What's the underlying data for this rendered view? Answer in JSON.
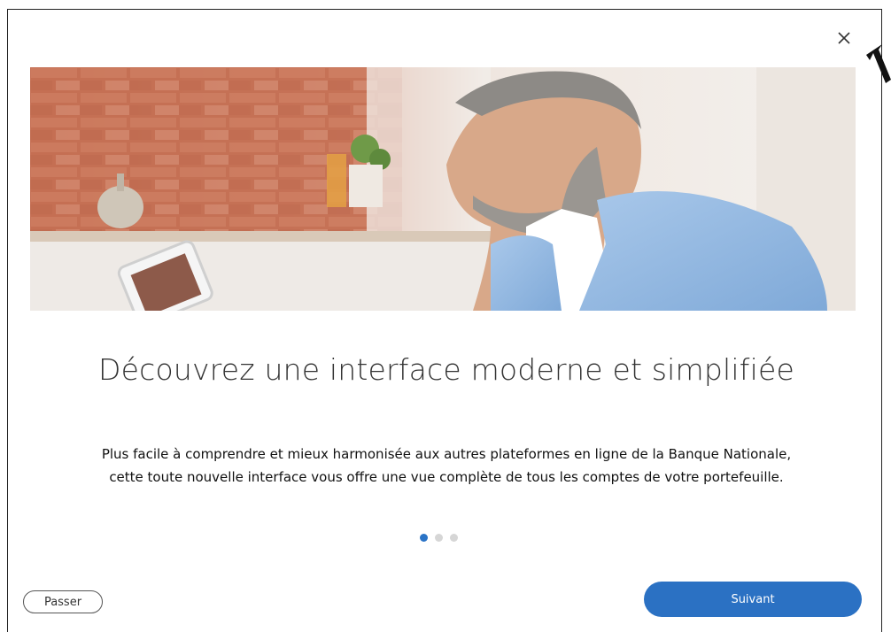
{
  "dialog": {
    "close_icon": "close-icon",
    "hero_image": "man-using-tablet-in-kitchen",
    "title": "Découvrez une interface moderne et simplifiée",
    "description": "Plus facile à comprendre et mieux harmonisée aux autres plateformes en ligne de la Banque Nationale, cette toute nouvelle interface vous offre une vue complète de tous les comptes de votre portefeuille.",
    "pagination": {
      "total": 3,
      "active_index": 0
    },
    "skip_label": "Passer",
    "next_label": "Suivant",
    "accent_color": "#2b71c3"
  },
  "annotation": {
    "icon": "pointer-arrow-icon"
  }
}
